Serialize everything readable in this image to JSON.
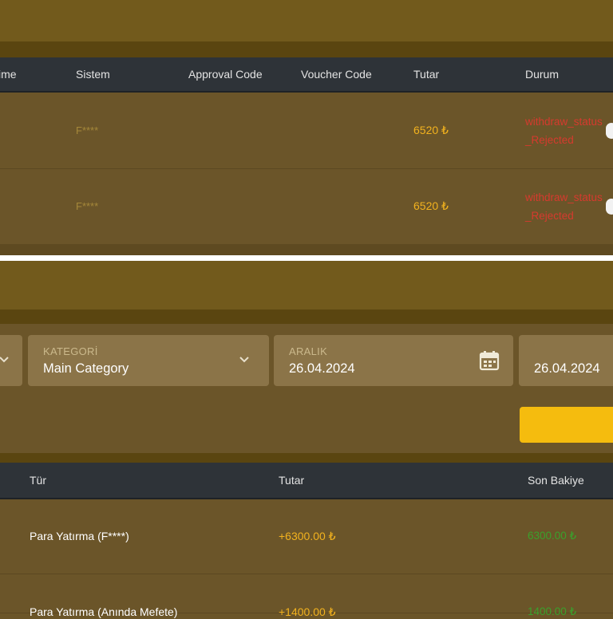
{
  "withdrawals": {
    "headers": {
      "time": "ime",
      "system": "Sistem",
      "approval_code": "Approval Code",
      "voucher_code": "Voucher Code",
      "amount": "Tutar",
      "status": "Durum"
    },
    "rows": [
      {
        "system": "F****",
        "amount": "6520 ₺",
        "status": "withdraw_status_Rejected"
      },
      {
        "system": "F****",
        "amount": "6520 ₺",
        "status": "withdraw_status_Rejected"
      }
    ]
  },
  "filters": {
    "category": {
      "label": "KATEGORİ",
      "value": "Main Category"
    },
    "range": {
      "label": "ARALIK",
      "value": "26.04.2024"
    },
    "range_end": {
      "value": "26.04.2024"
    },
    "icons": {
      "dropdown": "chevron-down-icon",
      "calendar": "calendar-icon"
    }
  },
  "transactions": {
    "headers": {
      "type": "Tür",
      "amount": "Tutar",
      "balance": "Son Bakiye"
    },
    "rows": [
      {
        "type": "Para Yatırma (F****)",
        "amount": "+6300.00 ₺",
        "balance": "6300.00 ₺"
      },
      {
        "type": "Para Yatırma (Anında Mefete)",
        "amount": "+1400.00 ₺",
        "balance": "1400.00 ₺"
      }
    ]
  },
  "colors": {
    "background": "#6b5529",
    "header": "#2e3338",
    "accent": "#f5bc0e",
    "rejected": "#d63a2e",
    "positive_balance": "#3aa12c"
  }
}
